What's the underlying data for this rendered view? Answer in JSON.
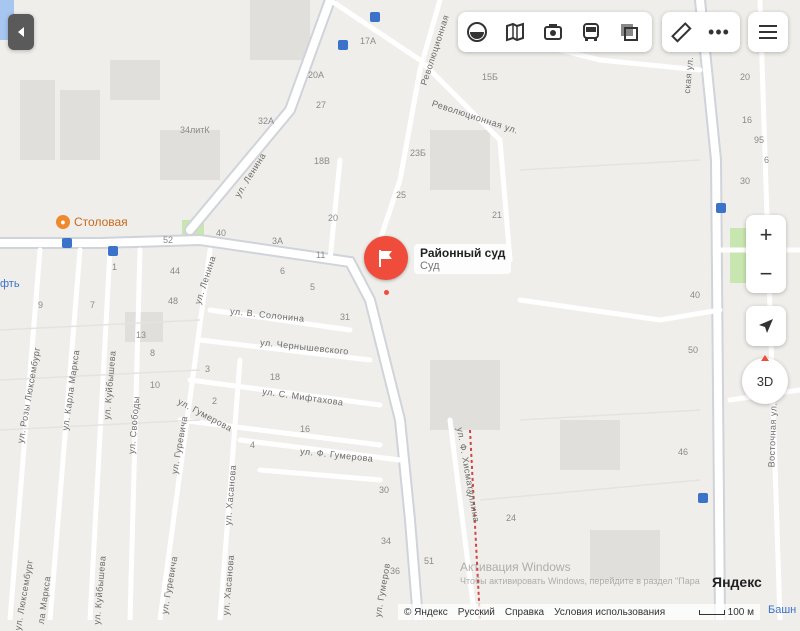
{
  "poi": {
    "title": "Районный суд",
    "category": "Суд"
  },
  "places": {
    "canteen": "Столовая",
    "canteen_partial": "фть"
  },
  "streets": [
    {
      "key": "lenina1",
      "text": "ул. Ленина"
    },
    {
      "key": "lenina2",
      "text": "ул. Ленина"
    },
    {
      "key": "revolution1",
      "text": "Революционная"
    },
    {
      "key": "revolution2",
      "text": "Революционная ул."
    },
    {
      "key": "solonina",
      "text": "ул. В. Солонина"
    },
    {
      "key": "chernysh",
      "text": "ул. Чернышевского"
    },
    {
      "key": "miftahova",
      "text": "ул. С. Мифтахова"
    },
    {
      "key": "gumerova1",
      "text": "ул. Гумерова"
    },
    {
      "key": "gumerova2",
      "text": "ул. Ф. Гумерова"
    },
    {
      "key": "gumerova3",
      "text": "ул. Гумеров"
    },
    {
      "key": "hismatullina",
      "text": "ул. Ф. Хисматуллина"
    },
    {
      "key": "lux1",
      "text": "ул. Розы Люксембург"
    },
    {
      "key": "lux2",
      "text": "ул. Люксембург"
    },
    {
      "key": "marx1",
      "text": "ул. Карла Маркса"
    },
    {
      "key": "marx2",
      "text": "ла Маркса"
    },
    {
      "key": "kuib1",
      "text": "ул. Куйбышева"
    },
    {
      "key": "kuib2",
      "text": "ул. Куйбышева"
    },
    {
      "key": "svobody",
      "text": "ул. Свободы"
    },
    {
      "key": "gurevicha1",
      "text": "ул. Гуревича"
    },
    {
      "key": "gurevicha2",
      "text": "ул. Гуревича"
    },
    {
      "key": "hasanova1",
      "text": "ул. Хасанова"
    },
    {
      "key": "hasanova2",
      "text": "ул. Хасанова"
    },
    {
      "key": "vostoch",
      "text": "Восточная ул."
    },
    {
      "key": "skaya",
      "text": "ская ул."
    }
  ],
  "house_numbers": [
    "17А",
    "20А",
    "27",
    "32А",
    "34литК",
    "18В",
    "15Б",
    "23Б",
    "25",
    "21",
    "20",
    "52",
    "40",
    "44",
    "48",
    "3А",
    "6",
    "11",
    "5",
    "13",
    "1",
    "9",
    "7",
    "31",
    "8",
    "4",
    "3",
    "2",
    "10",
    "18",
    "16",
    "30",
    "34",
    "36",
    "51",
    "24",
    "40",
    "50",
    "46",
    "30",
    "16",
    "6",
    "20",
    "95",
    "2"
  ],
  "toolbar": {
    "tools": [
      "layers-icon",
      "panorama-icon",
      "photo-icon",
      "transport-icon",
      "traffic-icon"
    ],
    "ruler": "ruler-icon",
    "more": "more-icon",
    "menu": "menu-icon"
  },
  "controls": {
    "zoom_in": "+",
    "zoom_out": "−",
    "view_3d": "3D"
  },
  "watermark": {
    "line1": "Активация Windows",
    "line2": "Чтобы активировать Windows, перейдите в раздел \"Пара"
  },
  "brand": "Яндекс",
  "footer": {
    "copyright": "© Яндекс",
    "language": "Русский",
    "help": "Справка",
    "terms": "Условия использования",
    "scale": "100 м",
    "partial": "Башн"
  }
}
